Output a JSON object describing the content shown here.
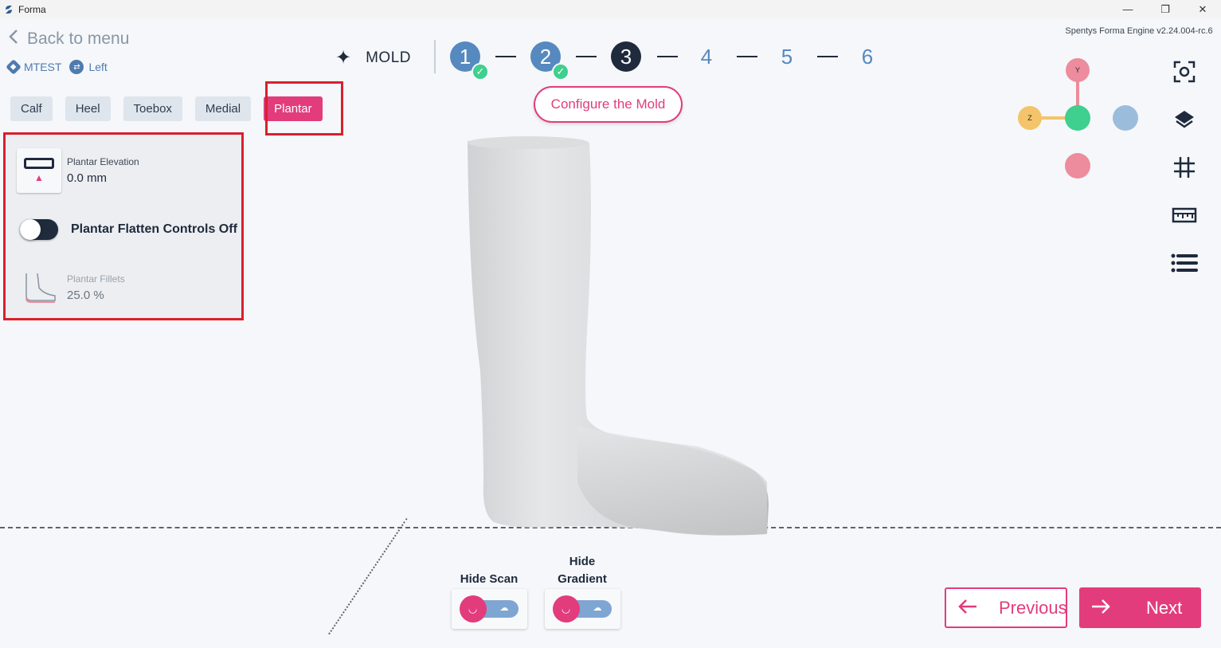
{
  "window": {
    "title": "Forma",
    "controls": {
      "minimize": "—",
      "maximize": "❐",
      "close": "✕"
    }
  },
  "header": {
    "back_label": "Back to menu",
    "patient": "MTEST",
    "side": "Left",
    "version": "Spentys Forma Engine v2.24.004-rc.6"
  },
  "stepper": {
    "section_label": "MOLD",
    "steps": [
      {
        "number": "1",
        "state": "done"
      },
      {
        "number": "2",
        "state": "done"
      },
      {
        "number": "3",
        "state": "current"
      },
      {
        "number": "4",
        "state": "todo"
      },
      {
        "number": "5",
        "state": "todo"
      },
      {
        "number": "6",
        "state": "todo"
      }
    ],
    "current_hint": "Configure the Mold"
  },
  "tabs": [
    {
      "label": "Calf",
      "active": false
    },
    {
      "label": "Heel",
      "active": false
    },
    {
      "label": "Toebox",
      "active": false
    },
    {
      "label": "Medial",
      "active": false
    },
    {
      "label": "Plantar",
      "active": true
    }
  ],
  "panel": {
    "elevation": {
      "label": "Plantar Elevation",
      "value": "0.0 mm"
    },
    "flatten": {
      "label": "Plantar Flatten Controls Off",
      "on": false
    },
    "fillets": {
      "label": "Plantar Fillets",
      "value": "25.0 %",
      "enabled": false
    }
  },
  "gizmo": {
    "y_label": "Y",
    "z_label": "Z",
    "colors": {
      "y": "#ec8c9c",
      "z": "#f4c46a",
      "x": "#9cbcdc",
      "center": "#3fcf8e"
    }
  },
  "tools": [
    {
      "icon": "camera-focus-icon"
    },
    {
      "icon": "layers-icon"
    },
    {
      "icon": "grid-icon"
    },
    {
      "icon": "ruler-icon"
    },
    {
      "icon": "list-icon"
    }
  ],
  "bottom_toggles": {
    "hide_scan": "Hide Scan",
    "hide_gradient_line1": "Hide",
    "hide_gradient_line2": "Gradient"
  },
  "nav": {
    "previous": "Previous",
    "next": "Next"
  },
  "colors": {
    "accent": "#e23c7c",
    "primary_dark": "#1f2a3c",
    "step_blue": "#5689bf",
    "done_green": "#3fcf8e",
    "highlight_red": "#d9202c"
  }
}
